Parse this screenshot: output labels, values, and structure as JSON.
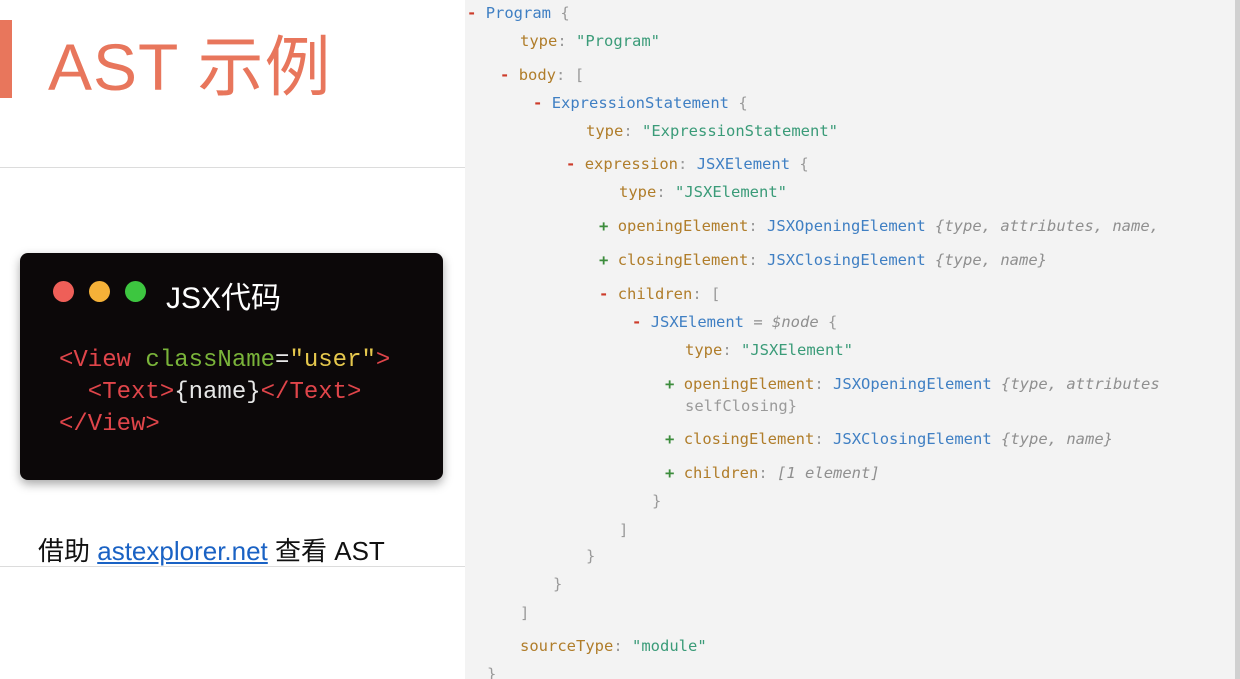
{
  "slide": {
    "title": "AST 示例",
    "card": {
      "title": "JSX代码",
      "dot_colors": [
        "#ef5f58",
        "#f5b138",
        "#3dc640"
      ],
      "code": [
        [
          {
            "t": "<View ",
            "c": "#e0454a"
          },
          {
            "t": "className",
            "c": "#7ab43a"
          },
          {
            "t": "=",
            "c": "#e8e8e8"
          },
          {
            "t": "\"user\"",
            "c": "#e6c84d"
          },
          {
            "t": ">",
            "c": "#e0454a"
          }
        ],
        [
          {
            "t": "  <Text>",
            "c": "#e0454a"
          },
          {
            "t": "{name}",
            "c": "#e8e8e8"
          },
          {
            "t": "</Text>",
            "c": "#e0454a"
          }
        ],
        [
          {
            "t": "</View>",
            "c": "#e0454a"
          }
        ]
      ]
    },
    "caption": {
      "prefix": "借助 ",
      "link": "astexplorer.net",
      "suffix": " 查看 AST"
    }
  },
  "ast": {
    "lines": [
      {
        "toggle": "-",
        "key": "Program",
        "type": "",
        "tail": "{"
      },
      {
        "key": "type",
        "value": "\"Program\""
      },
      {
        "toggle": "-",
        "key": "body",
        "tail": "["
      },
      {
        "toggle": "-",
        "key": "ExpressionStatement",
        "tail": "{"
      },
      {
        "key": "type",
        "value": "\"ExpressionStatement\""
      },
      {
        "toggle": "-",
        "key": "expression",
        "type": "JSXElement",
        "tail": "{"
      },
      {
        "key": "type",
        "value": "\"JSXElement\""
      },
      {
        "toggle": "+",
        "key": "openingElement",
        "type": "JSXOpeningElement",
        "summary": "{type, attributes, name,"
      },
      {
        "toggle": "+",
        "key": "closingElement",
        "type": "JSXClosingElement",
        "summary": "{type, name}"
      },
      {
        "toggle": "-",
        "key": "children",
        "tail": "["
      },
      {
        "toggle": "-",
        "key": "JSXElement",
        "alias": "= $node",
        "tail": "{"
      },
      {
        "key": "type",
        "value": "\"JSXElement\""
      },
      {
        "toggle": "+",
        "key": "openingElement",
        "type": "JSXOpeningElement",
        "summary": "{type, attributes"
      },
      {
        "text": "selfClosing}"
      },
      {
        "toggle": "+",
        "key": "closingElement",
        "type": "JSXClosingElement",
        "summary": "{type, name}"
      },
      {
        "toggle": "+",
        "key": "children",
        "summary": "[1 element]"
      },
      {
        "text": "}"
      },
      {
        "text": "]"
      },
      {
        "text": "}"
      },
      {
        "text": "}"
      },
      {
        "text": "]"
      },
      {
        "key": "sourceType",
        "value": "\"module\""
      },
      {
        "text": "}"
      }
    ]
  }
}
